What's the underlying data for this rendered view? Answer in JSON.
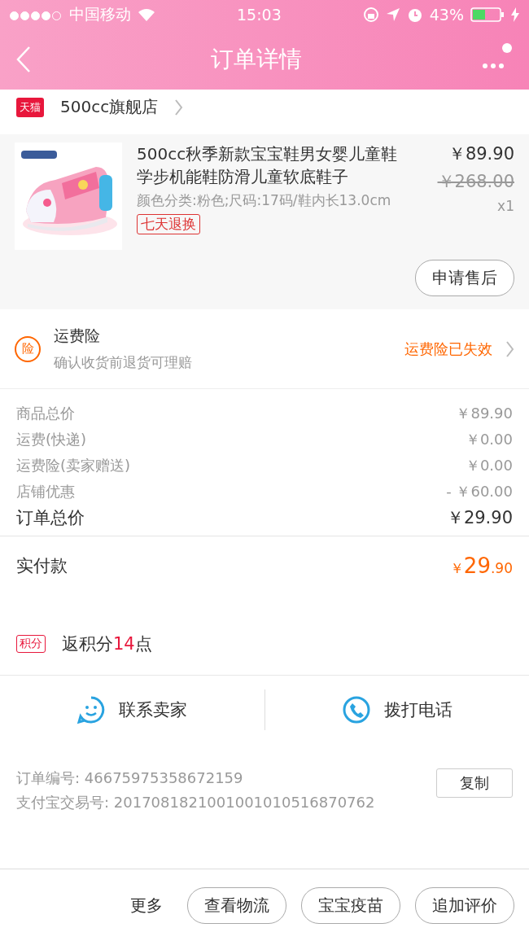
{
  "status_bar": {
    "carrier": "中国移动",
    "time": "15:03",
    "battery": "43%",
    "signal_dots": [
      true,
      true,
      true,
      true,
      false
    ]
  },
  "nav": {
    "title": "订单详情"
  },
  "shop": {
    "badge": "天猫",
    "name": "500cc旗舰店"
  },
  "product": {
    "title": "500cc秋季新款宝宝鞋男女婴儿童鞋学步机能鞋防滑儿童软底鞋子",
    "spec": "颜色分类:粉色;尺码:17码/鞋内长13.0cm",
    "tag": "七天退换",
    "price": "￥89.90",
    "original_price": "￥268.00",
    "quantity": "x1",
    "action": "申请售后"
  },
  "insurance": {
    "icon": "险",
    "title": "运费险",
    "subtitle": "确认收货前退货可理赔",
    "status": "运费险已失效"
  },
  "costs": [
    {
      "label": "商品总价",
      "value": "￥89.90",
      "kind": "line"
    },
    {
      "label": "运费(快递)",
      "value": "￥0.00",
      "kind": "line"
    },
    {
      "label": "运费险(卖家赠送)",
      "value": "￥0.00",
      "kind": "line"
    },
    {
      "label": "店铺优惠",
      "value": "- ￥60.00",
      "kind": "line"
    },
    {
      "label": "订单总价",
      "value": "￥29.90",
      "kind": "total"
    }
  ],
  "paid": {
    "label": "实付款",
    "currency": "￥",
    "integer": "29",
    "decimal": ".90"
  },
  "points": {
    "badge": "积分",
    "text": "返积分**14**点"
  },
  "contacts": [
    {
      "label": "联系卖家",
      "kind": "chat"
    },
    {
      "label": "拨打电话",
      "kind": "phone"
    }
  ],
  "order_info": [
    {
      "label": "订单编号:",
      "value": "46675975358672159"
    },
    {
      "label": "支付宝交易号:",
      "value": "2017081821001001010516870762"
    }
  ],
  "copy_button": "复制",
  "bottom_bar": {
    "more": "更多",
    "buttons": [
      "查看物流",
      "宝宝疫苗",
      "追加评价"
    ]
  }
}
